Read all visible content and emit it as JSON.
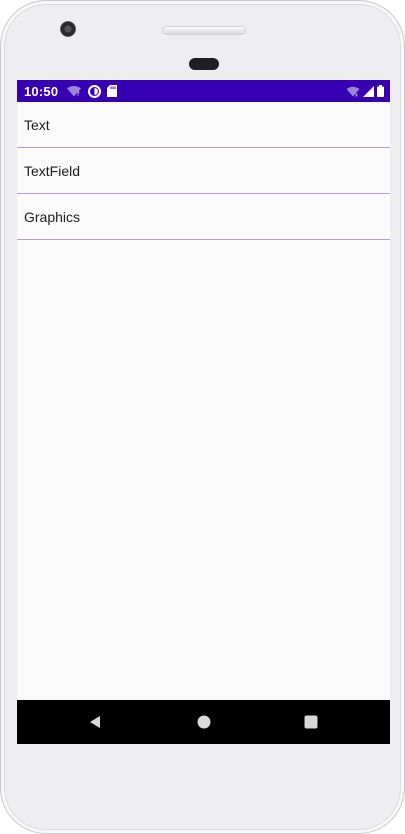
{
  "status_bar": {
    "time": "10:50",
    "icons_left": [
      "wifi-question-icon",
      "data-saver-icon",
      "sd-card-icon"
    ],
    "icons_right": [
      "wifi-icon",
      "cell-signal-icon",
      "battery-icon"
    ]
  },
  "list": {
    "items": [
      {
        "label": "Text"
      },
      {
        "label": "TextField"
      },
      {
        "label": "Graphics"
      }
    ]
  },
  "nav_bar": {
    "buttons": [
      "back-icon",
      "home-icon",
      "recents-icon"
    ]
  },
  "colors": {
    "status_bar": "#3700b3",
    "divider": "#b497e8",
    "screen_background": "#fafafa",
    "nav_bar": "#000000"
  }
}
